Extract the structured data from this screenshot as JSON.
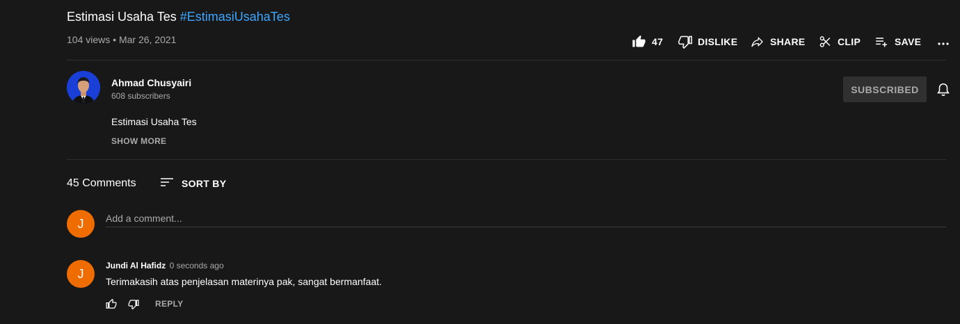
{
  "video": {
    "title": "Estimasi Usaha Tes",
    "hashtag": "#EstimasiUsahaTes",
    "views": "104 views",
    "separator": "•",
    "date": "Mar 26, 2021"
  },
  "actions": {
    "like_count": "47",
    "dislike_label": "DISLIKE",
    "share_label": "SHARE",
    "clip_label": "CLIP",
    "save_label": "SAVE"
  },
  "channel": {
    "name": "Ahmad Chusyairi",
    "subscribers": "608 subscribers",
    "subscribe_label": "SUBSCRIBED",
    "avatar_bg": "#1a3fd6"
  },
  "description": {
    "text": "Estimasi Usaha Tes",
    "show_more": "SHOW MORE"
  },
  "comments": {
    "count": "45 Comments",
    "sort_label": "SORT BY",
    "input_placeholder": "Add a comment...",
    "current_user_initial": "J",
    "items": [
      {
        "initial": "J",
        "author": "Jundi Al Hafidz",
        "time": "0 seconds ago",
        "text": "Terimakasih atas penjelasan materinya pak, sangat bermanfaat.",
        "reply_label": "REPLY"
      }
    ]
  },
  "colors": {
    "background": "#181818",
    "link": "#3ea6ff",
    "avatar_orange": "#ef6c00",
    "muted_text": "#aaaaaa"
  },
  "icons": [
    "thumb-up-icon",
    "thumb-down-icon",
    "share-icon",
    "scissors-icon",
    "playlist-add-icon",
    "more-icon",
    "bell-icon",
    "sort-icon"
  ]
}
